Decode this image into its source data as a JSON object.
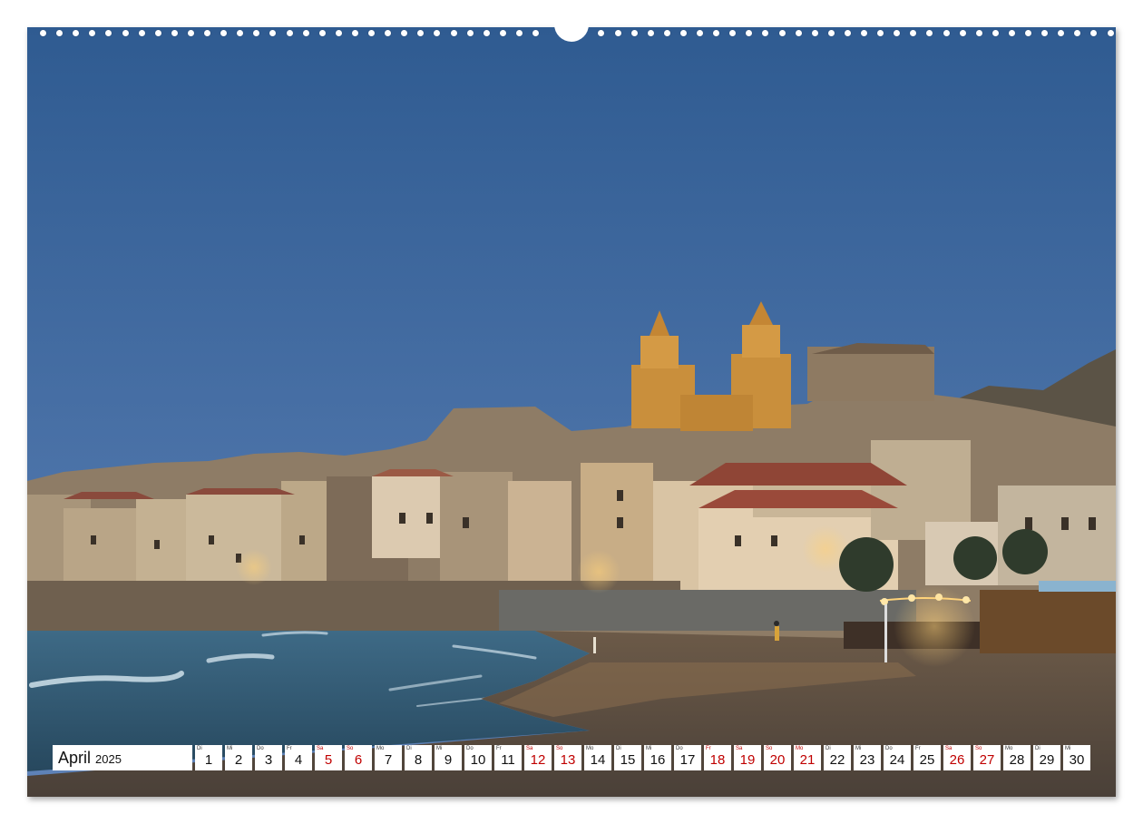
{
  "calendar": {
    "month": "April",
    "year": "2025",
    "days": [
      {
        "wd": "Di",
        "num": "1",
        "weekend": false
      },
      {
        "wd": "Mi",
        "num": "2",
        "weekend": false
      },
      {
        "wd": "Do",
        "num": "3",
        "weekend": false
      },
      {
        "wd": "Fr",
        "num": "4",
        "weekend": false
      },
      {
        "wd": "Sa",
        "num": "5",
        "weekend": true
      },
      {
        "wd": "So",
        "num": "6",
        "weekend": true
      },
      {
        "wd": "Mo",
        "num": "7",
        "weekend": false
      },
      {
        "wd": "Di",
        "num": "8",
        "weekend": false
      },
      {
        "wd": "Mi",
        "num": "9",
        "weekend": false
      },
      {
        "wd": "Do",
        "num": "10",
        "weekend": false
      },
      {
        "wd": "Fr",
        "num": "11",
        "weekend": false
      },
      {
        "wd": "Sa",
        "num": "12",
        "weekend": true
      },
      {
        "wd": "So",
        "num": "13",
        "weekend": true
      },
      {
        "wd": "Mo",
        "num": "14",
        "weekend": false
      },
      {
        "wd": "Di",
        "num": "15",
        "weekend": false
      },
      {
        "wd": "Mi",
        "num": "16",
        "weekend": false
      },
      {
        "wd": "Do",
        "num": "17",
        "weekend": false
      },
      {
        "wd": "Fr",
        "num": "18",
        "weekend": true
      },
      {
        "wd": "Sa",
        "num": "19",
        "weekend": true
      },
      {
        "wd": "So",
        "num": "20",
        "weekend": true
      },
      {
        "wd": "Mo",
        "num": "21",
        "weekend": true
      },
      {
        "wd": "Di",
        "num": "22",
        "weekend": false
      },
      {
        "wd": "Mi",
        "num": "23",
        "weekend": false
      },
      {
        "wd": "Do",
        "num": "24",
        "weekend": false
      },
      {
        "wd": "Fr",
        "num": "25",
        "weekend": false
      },
      {
        "wd": "Sa",
        "num": "26",
        "weekend": true
      },
      {
        "wd": "So",
        "num": "27",
        "weekend": true
      },
      {
        "wd": "Mo",
        "num": "28",
        "weekend": false
      },
      {
        "wd": "Di",
        "num": "29",
        "weekend": false
      },
      {
        "wd": "Mi",
        "num": "30",
        "weekend": false
      }
    ]
  },
  "colors": {
    "weekend": "#c00000",
    "sky_top": "#2f5b91",
    "sky_bottom": "#5f83b8"
  }
}
